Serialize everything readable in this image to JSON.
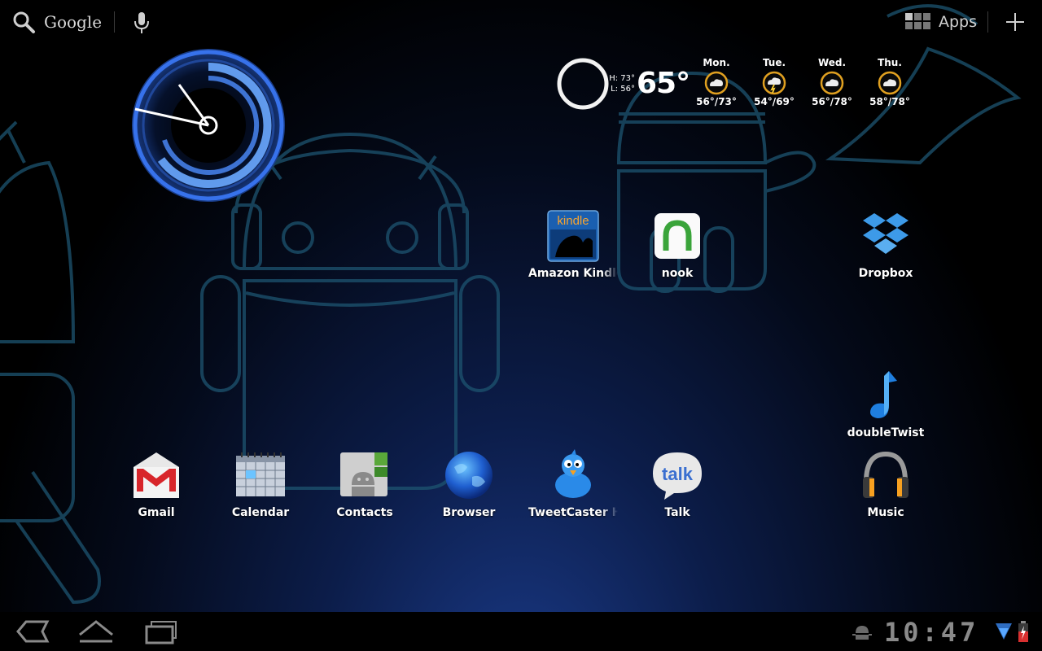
{
  "top_bar": {
    "search_label": "Google",
    "search_icon": "search-icon",
    "voice_icon": "microphone-icon",
    "apps_label": "Apps",
    "apps_icon": "app-grid-icon",
    "add_icon": "plus-icon"
  },
  "weather": {
    "high": "H: 73°",
    "low": "L: 56°",
    "temp": "65°",
    "forecast": [
      {
        "day": "Mon.",
        "range": "56°/73°"
      },
      {
        "day": "Tue.",
        "range": "54°/69°"
      },
      {
        "day": "Wed.",
        "range": "56°/78°"
      },
      {
        "day": "Thu.",
        "range": "58°/78°"
      }
    ]
  },
  "apps": {
    "kindle": {
      "name": "Amazon Kindle",
      "icon_text": "kindle"
    },
    "nook": {
      "name": "nook"
    },
    "dropbox": {
      "name": "Dropbox"
    },
    "doubletwist": {
      "name": "doubleTwist"
    },
    "gmail": {
      "name": "Gmail"
    },
    "calendar": {
      "name": "Calendar"
    },
    "contacts": {
      "name": "Contacts"
    },
    "browser": {
      "name": "Browser"
    },
    "tweetcaster": {
      "name": "TweetCaster HD"
    },
    "talk": {
      "name": "Talk",
      "icon_text": "talk"
    },
    "music": {
      "name": "Music"
    }
  },
  "system_bar": {
    "time": "10:47",
    "back_icon": "back-icon",
    "home_icon": "home-icon",
    "recents_icon": "recent-apps-icon",
    "debug_icon": "android-debug-icon",
    "signal_icon": "wifi-signal-icon",
    "battery_icon": "battery-charging-icon"
  },
  "colors": {
    "clock_blue": "#4a90ff",
    "wallpaper_line": "#1e5a78",
    "sysbar_text": "#8a8a8a"
  }
}
